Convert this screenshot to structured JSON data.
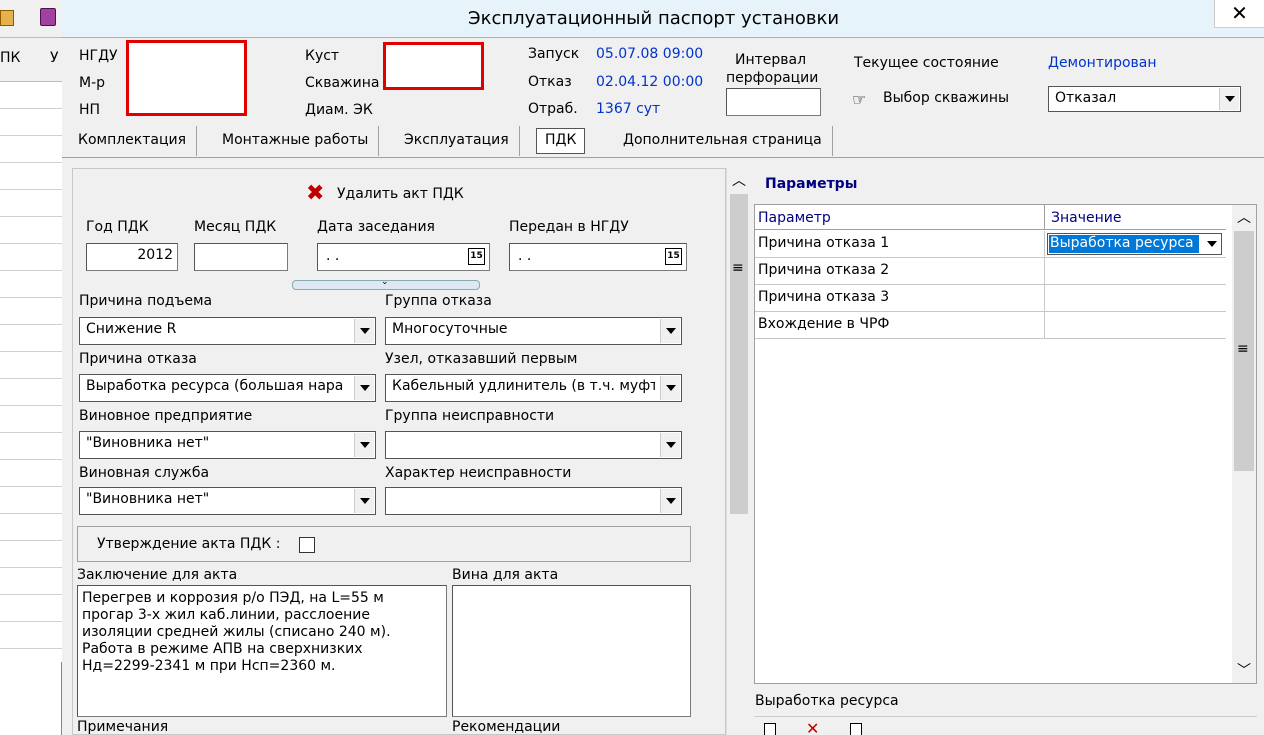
{
  "window": {
    "title": "Эксплуатационный паспорт установки",
    "close_glyph": "✕"
  },
  "left_strip": {
    "labels": [
      "ПК",
      "У"
    ]
  },
  "header": {
    "ngdu_label": "НГДУ",
    "mr_label": "М-р",
    "np_label": "НП",
    "kust_label": "Куст",
    "skv_label": "Скважина",
    "diam_label": "Диам. ЭК",
    "zapusk_label": "Запуск",
    "zapusk_value": "05.07.08 09:00",
    "otkaz_label": "Отказ",
    "otkaz_value": "02.04.12 00:00",
    "otrab_label": "Отраб.",
    "otrab_value": "1367 сут",
    "interval_label_1": "Интервал",
    "interval_label_2": "перфорации",
    "state_label": "Текущее состояние",
    "state_value": "Демонтирован",
    "select_well_label": "Выбор скважины",
    "status_combo_value": "Отказал"
  },
  "tabs": [
    "Комплектация",
    "Монтажные работы",
    "Эксплуатация",
    "ПДК",
    "Дополнительная страница"
  ],
  "form": {
    "delete_act_label": "Удалить акт ПДК",
    "year_label": "Год ПДК",
    "year_value": "2012",
    "month_label": "Месяц ПДК",
    "meeting_date_label": "Дата заседания",
    "meeting_date_value": ". .",
    "sent_label": "Передан в НГДУ",
    "sent_value": ". .",
    "date_btn_label": "15",
    "lift_reason_label": "Причина подъема",
    "lift_reason_value": "Снижение R",
    "failure_group_label": "Группа отказа",
    "failure_group_value": "Многосуточные",
    "failure_reason_label": "Причина отказа",
    "failure_reason_value": "Выработка ресурса (большая нара",
    "first_node_label": "Узел, отказавший первым",
    "first_node_value": "Кабельный удлинитель (в т.ч. муфт",
    "guilty_company_label": "Виновное предприятие",
    "guilty_company_value": "\"Виновника нет\"",
    "fault_group_label": "Группа неисправности",
    "fault_group_value": "",
    "guilty_service_label": "Виновная служба",
    "guilty_service_value": "\"Виновника нет\"",
    "fault_nature_label": "Характер неисправности",
    "fault_nature_value": "",
    "approval_label": "Утверждение акта ПДК :",
    "conclusion_label": "Заключение для акта",
    "conclusion_lines": [
      "Перегрев и коррозия р/о ПЭД, на L=55 м",
      "прогар 3-х жил каб.линии, расслоение",
      "изоляции средней жилы (списано 240 м).",
      "Работа в режиме АПВ на сверхнизких",
      "Нд=2299-2341 м при Нсп=2360 м."
    ],
    "guilt_label": "Вина для акта",
    "notes_label": "Примечания",
    "recommend_label": "Рекомендации"
  },
  "params": {
    "title": "Параметры",
    "col_param": "Параметр",
    "col_value": "Значение",
    "rows": [
      {
        "param": "Причина отказа 1",
        "value": "Выработка ресурса"
      },
      {
        "param": "Причина отказа 2",
        "value": ""
      },
      {
        "param": "Причина отказа 3",
        "value": ""
      },
      {
        "param": "Вхождение в ЧРФ",
        "value": ""
      }
    ],
    "status_text": "Выработка ресурса"
  },
  "colors": {
    "accent_blue": "#0033cc",
    "panel_bg": "#f0f0f0",
    "title_bg": "#e7f3fb",
    "selection": "#0078d7",
    "redact": "#e00000",
    "header_blue": "#000080"
  }
}
